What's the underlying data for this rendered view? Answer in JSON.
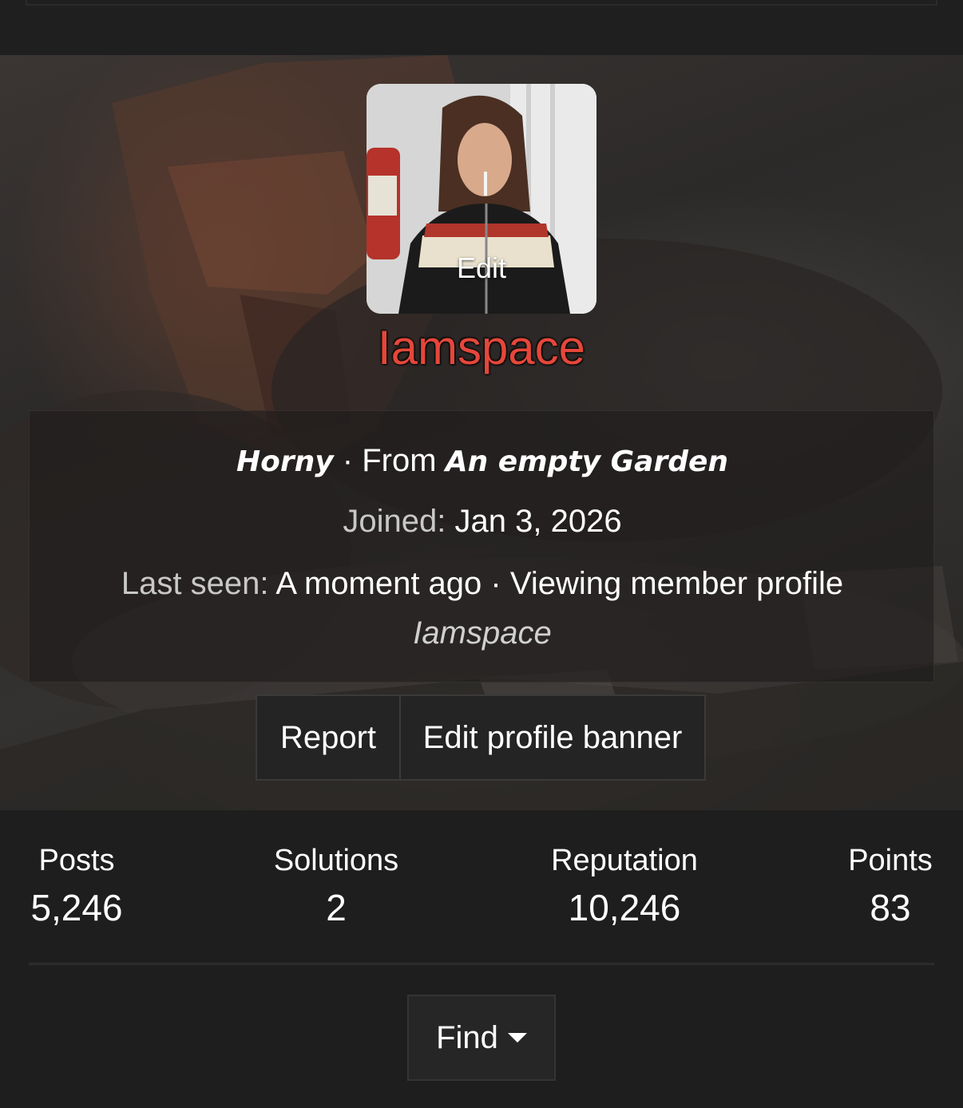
{
  "profile": {
    "avatar_edit_label": "Edit",
    "username": "Iamspace",
    "custom_title": "Horny",
    "separator": "·",
    "from_prefix": "From",
    "location": "An empty Garden",
    "joined_label": "Joined:",
    "joined_value": "Jan 3, 2026",
    "last_seen_label": "Last seen:",
    "last_seen_value": "A moment ago",
    "activity": "Viewing member profile",
    "activity_target": "Iamspace"
  },
  "actions": {
    "report_label": "Report",
    "edit_banner_label": "Edit profile banner"
  },
  "stats": [
    {
      "label": "Posts",
      "value": "5,246"
    },
    {
      "label": "Solutions",
      "value": "2"
    },
    {
      "label": "Reputation",
      "value": "10,246"
    },
    {
      "label": "Points",
      "value": "83"
    }
  ],
  "find": {
    "label": "Find",
    "icon": "caret-down-icon"
  },
  "colors": {
    "username": "#e5473a",
    "background": "#1c1c1c",
    "button_bg": "#242424"
  }
}
